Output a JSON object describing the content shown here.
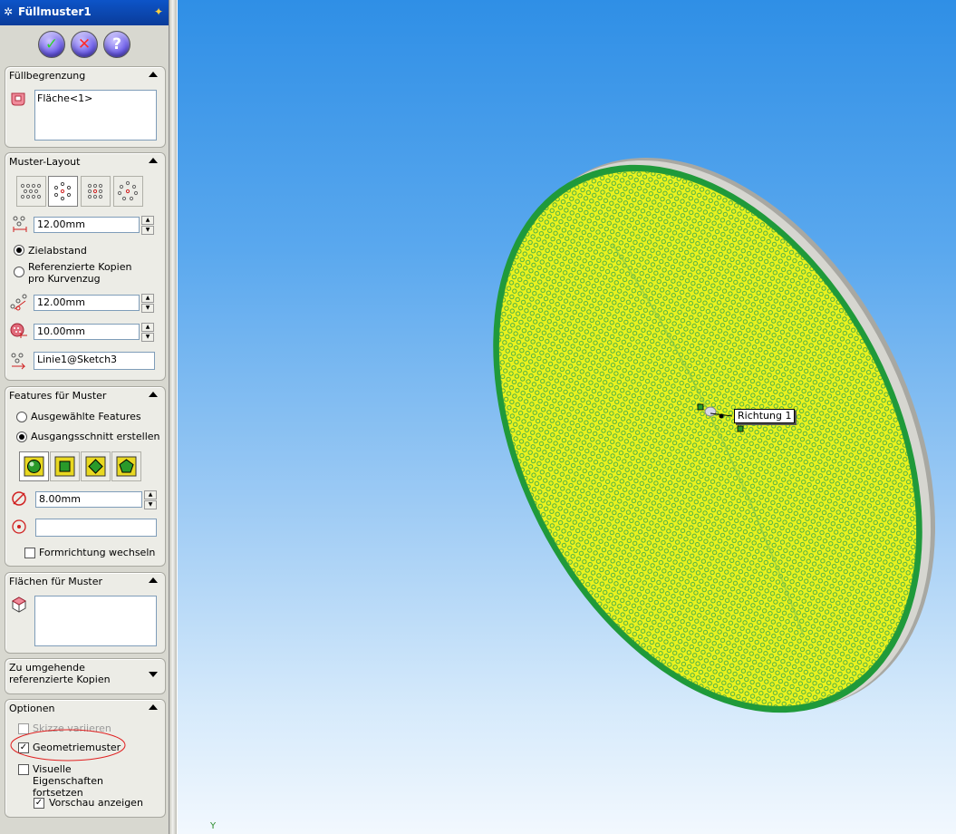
{
  "panel": {
    "title": "Füllmuster1",
    "title_icon": "fill-pattern-icon",
    "pin_icon": "pushpin-icon",
    "buttons": {
      "ok": "✓",
      "cancel": "✕",
      "help": "?"
    }
  },
  "groups": {
    "boundary": {
      "header": "Füllbegrenzung",
      "list_items": [
        "Fläche<1>"
      ]
    },
    "layout": {
      "header": "Muster-Layout",
      "spacing": "12.00mm",
      "target_spacing": "Zielabstand",
      "ref_copies": "Referenzierte Kopien pro Kurvenzug",
      "loop_spacing": "12.00mm",
      "margin": "10.00mm",
      "direction": "Linie1@Sketch3"
    },
    "features": {
      "header": "Features für Muster",
      "selected_features": "Ausgewählte Features",
      "create_seed": "Ausgangsschnitt erstellen",
      "diameter": "8.00mm",
      "vertex": "",
      "flip": "Formrichtung wechseln"
    },
    "faces": {
      "header": "Flächen für Muster"
    },
    "skip": {
      "header": "Zu umgehende referenzierte Kopien"
    },
    "options": {
      "header": "Optionen",
      "vary_sketch": "Skizze variieren",
      "geometry_pattern": "Geometriemuster",
      "propagate_visual": "Visuelle Eigenschaften fortsetzen",
      "show_preview": "Vorschau anzeigen"
    }
  },
  "viewport": {
    "callout": "Richtung 1",
    "axis_label": "Y"
  },
  "colors": {
    "titlebar": "#0d54c8",
    "panel": "#d8d8d0",
    "disc_fill": "#e6f21a",
    "disc_edge": "#1f9a3a",
    "highlight_ring": "#e02020"
  }
}
